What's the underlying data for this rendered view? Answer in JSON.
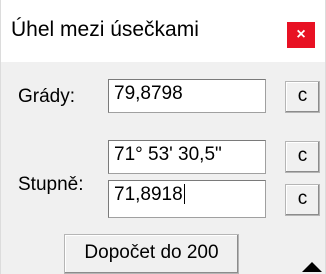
{
  "window": {
    "title": "Úhel mezi úsečkami",
    "close_label": "×"
  },
  "degrees": {
    "label": "Grády:",
    "value": "79,8798",
    "clear_label": "c"
  },
  "stupne": {
    "label": "Stupně:",
    "dms_value": "71° 53' 30,5\"",
    "decimal_value": "71,8918",
    "dms_clear_label": "c",
    "decimal_clear_label": "c"
  },
  "actions": {
    "compute_label": "Dopočet do 200"
  },
  "icons": {
    "expand": "triangle-up-icon"
  },
  "colors": {
    "close_button": "#e81123",
    "dialog_background": "#f0f0f0"
  }
}
